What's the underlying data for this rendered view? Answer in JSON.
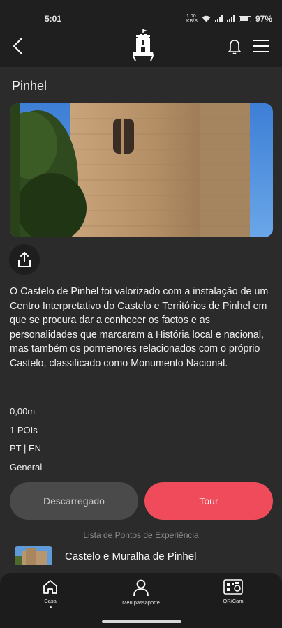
{
  "status_bar": {
    "time": "5:01",
    "network": "1.00 KB/S",
    "battery": "97%"
  },
  "header": {
    "back_icon": "chevron-left-icon",
    "logo_icon": "castle-logo-icon",
    "bell_icon": "bell-icon",
    "menu_icon": "hamburger-menu-icon"
  },
  "page": {
    "title": "Pinhel",
    "hero_image": "castle-tower-photo",
    "share_icon": "share-icon",
    "description": "O Castelo de Pinhel foi valorizado com a instalação de um Centro Interpretativo do Castelo e Territórios de Pinhel em que se procura dar a conhecer os factos e as personalidades que marcaram a História local e nacional, mas também os pormenores relacionados com o próprio Castelo, classificado como Monumento Nacional.",
    "meta": {
      "distance": "0,00m",
      "pois": "1 POIs",
      "languages": "PT | EN",
      "category": "General"
    }
  },
  "actions": {
    "downloaded_label": "Descarregado",
    "tour_label": "Tour"
  },
  "poi_section": {
    "heading": "Lista de Pontos de Experiência",
    "items": [
      {
        "name": "Castelo e Muralha de Pinhel"
      }
    ]
  },
  "bottom_nav": {
    "items": [
      {
        "label": "Casa",
        "icon": "home-icon",
        "active": true
      },
      {
        "label": "Meu passaporte",
        "icon": "person-icon",
        "active": false
      },
      {
        "label": "QR/Cam",
        "icon": "qr-camera-icon",
        "active": false
      }
    ]
  },
  "colors": {
    "background": "#2b2b2b",
    "header": "#1f1f1f",
    "accent": "#ef4b5b",
    "secondary_button": "#4a4a4a"
  }
}
